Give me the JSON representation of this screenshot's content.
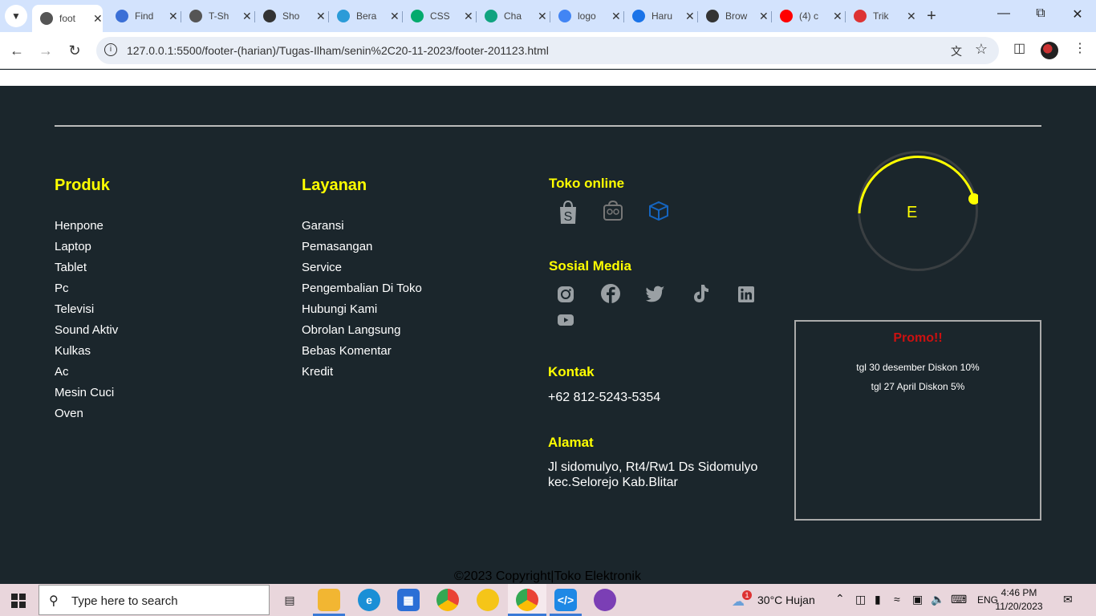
{
  "browser": {
    "tabs": [
      {
        "title": "foot",
        "favicon": "globe-icon",
        "color": "#555555",
        "active": true
      },
      {
        "title": "Find",
        "favicon": "flag-icon",
        "color": "#3b6fd6"
      },
      {
        "title": "T-Sh",
        "favicon": "globe-icon",
        "color": "#555555"
      },
      {
        "title": "Sho",
        "favicon": "shop-icon",
        "color": "#333333"
      },
      {
        "title": "Bera",
        "favicon": "edge-icon",
        "color": "#2b9bd8"
      },
      {
        "title": "CSS",
        "favicon": "w3-icon",
        "color": "#04aa6d"
      },
      {
        "title": "Cha",
        "favicon": "chatgpt-icon",
        "color": "#10a37f"
      },
      {
        "title": "logo",
        "favicon": "google-icon",
        "color": "#4285f4"
      },
      {
        "title": "Haru",
        "favicon": "s-icon",
        "color": "#1a73e8"
      },
      {
        "title": "Brow",
        "favicon": "smiley-icon",
        "color": "#333333"
      },
      {
        "title": "(4) c",
        "favicon": "youtube-icon",
        "color": "#ff0000"
      },
      {
        "title": "Trik",
        "favicon": "diamond-icon",
        "color": "#d33"
      }
    ],
    "url": "127.0.0.1:5500/footer-(harian)/Tugas-Ilham/senin%2C20-11-2023/footer-201123.html"
  },
  "footer": {
    "produk": {
      "title": "Produk",
      "items": [
        "Henpone",
        "Laptop",
        "Tablet",
        "Pc",
        "Televisi",
        "Sound Aktiv",
        "Kulkas",
        "Ac",
        "Mesin Cuci",
        "Oven"
      ]
    },
    "layanan": {
      "title": "Layanan",
      "items": [
        "Garansi",
        "Pemasangan",
        "Service",
        "Pengembalian Di Toko",
        "Hubungi Kami",
        "Obrolan Langsung",
        "Bebas Komentar",
        "Kredit"
      ]
    },
    "toko_online": {
      "title": "Toko online",
      "icons": [
        "shopee-icon",
        "tokopedia-icon",
        "box-icon"
      ]
    },
    "sosial_media": {
      "title": "Sosial Media",
      "icons": [
        "instagram-icon",
        "facebook-icon",
        "twitter-icon",
        "tiktok-icon",
        "linkedin-icon",
        "youtube-icon"
      ]
    },
    "kontak": {
      "title": "Kontak",
      "phone": "+62 812-5243-5354"
    },
    "alamat": {
      "title": "Alamat",
      "line1": "Jl sidomulyo, Rt4/Rw1 Ds Sidomulyo",
      "line2": "kec.Selorejo Kab.Blitar"
    },
    "loader_letter": "E",
    "promo": {
      "title": "Promo!!",
      "items": [
        "tgl 30 desember Diskon 10%",
        "tgl 27 April Diskon 5%"
      ]
    },
    "copyright": "©2023 Copyright|Toko Elektronik"
  },
  "taskbar": {
    "search_placeholder": "Type here to search",
    "weather": "30°C  Hujan",
    "weather_badge": "1",
    "language": "ENG",
    "time": "4:46 PM",
    "date": "11/20/2023"
  },
  "colors": {
    "footer_bg": "#1b262c",
    "heading": "#ffff00",
    "promo_title": "#cc1111"
  }
}
